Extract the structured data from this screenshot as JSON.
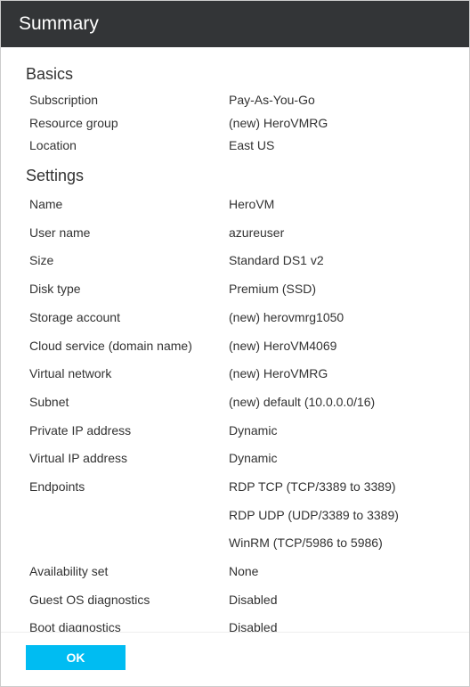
{
  "header": {
    "title": "Summary"
  },
  "sections": {
    "basics": {
      "title": "Basics",
      "rows": [
        {
          "label": "Subscription",
          "value": "Pay-As-You-Go"
        },
        {
          "label": "Resource group",
          "value": "(new) HeroVMRG"
        },
        {
          "label": "Location",
          "value": "East US"
        }
      ]
    },
    "settings": {
      "title": "Settings",
      "rows": [
        {
          "label": "Name",
          "value": "HeroVM"
        },
        {
          "label": "User name",
          "value": "azureuser"
        },
        {
          "label": "Size",
          "value": "Standard DS1 v2"
        },
        {
          "label": "Disk type",
          "value": "Premium (SSD)"
        },
        {
          "label": "Storage account",
          "value": "(new) herovmrg1050"
        },
        {
          "label": "Cloud service (domain name)",
          "value": "(new) HeroVM4069"
        },
        {
          "label": "Virtual network",
          "value": "(new) HeroVMRG"
        },
        {
          "label": "Subnet",
          "value": "(new) default (10.0.0.0/16)"
        },
        {
          "label": "Private IP address",
          "value": "Dynamic"
        },
        {
          "label": "Virtual IP address",
          "value": "Dynamic"
        },
        {
          "label": "Endpoints",
          "value": "RDP TCP (TCP/3389 to 3389)"
        },
        {
          "label": "",
          "value": "RDP UDP (UDP/3389 to 3389)"
        },
        {
          "label": "",
          "value": "WinRM (TCP/5986 to 5986)"
        },
        {
          "label": "Availability set",
          "value": "None"
        },
        {
          "label": "Guest OS diagnostics",
          "value": "Disabled"
        },
        {
          "label": "Boot diagnostics",
          "value": "Disabled"
        }
      ]
    }
  },
  "footer": {
    "ok_label": "OK"
  }
}
